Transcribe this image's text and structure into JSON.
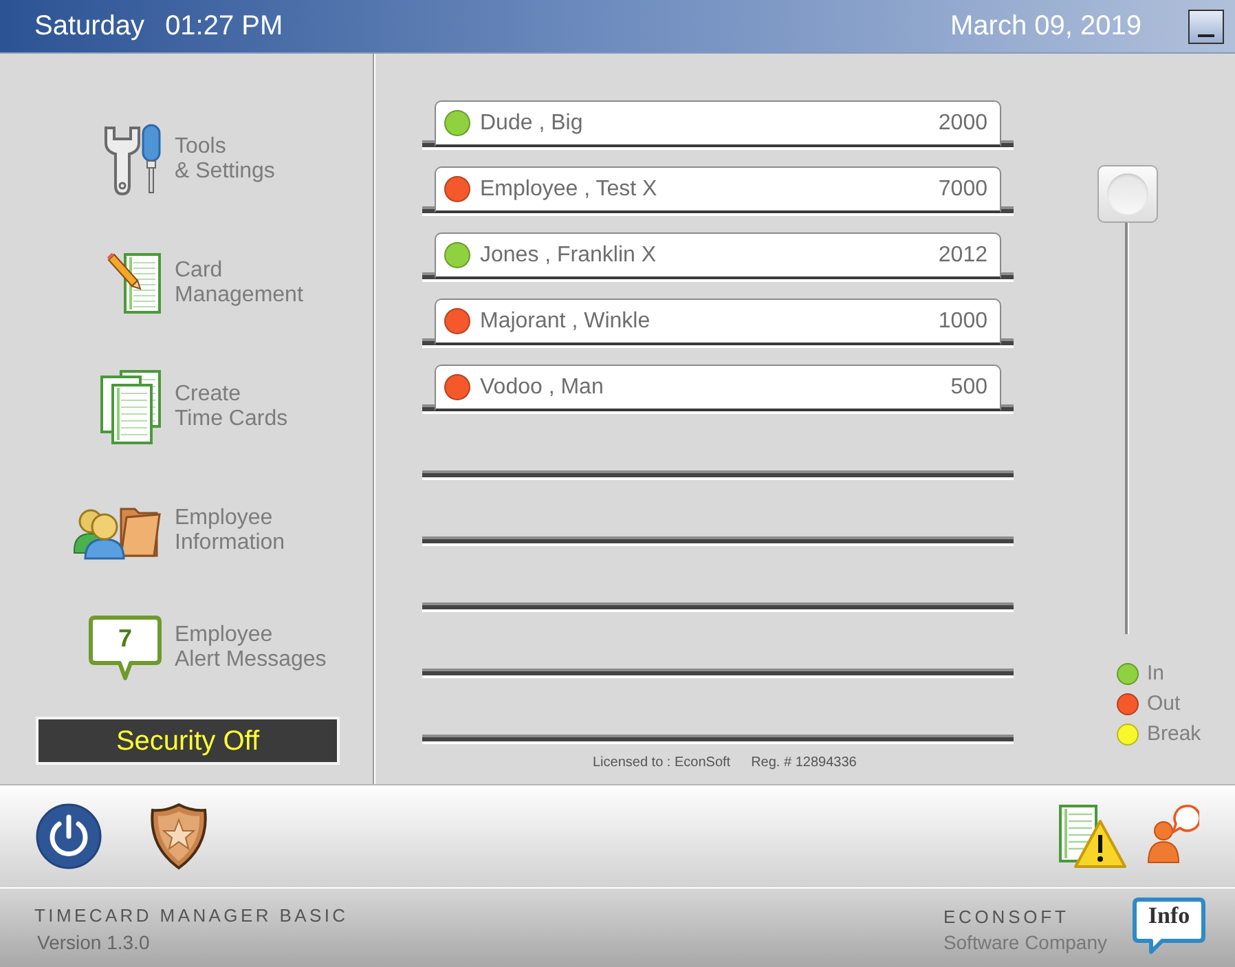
{
  "header": {
    "day": "Saturday",
    "time": "01:27 PM",
    "date": "March 09, 2019"
  },
  "sidebar": {
    "items": [
      {
        "kind": "tools",
        "label_lines": [
          "Tools",
          "& Settings"
        ]
      },
      {
        "kind": "card",
        "label_lines": [
          "Card",
          "Management"
        ]
      },
      {
        "kind": "timecards",
        "label_lines": [
          "Create",
          "Time Cards"
        ]
      },
      {
        "kind": "employee",
        "label_lines": [
          "Employee",
          "Information"
        ]
      },
      {
        "kind": "alerts",
        "label_lines": [
          "Employee",
          "Alert Messages"
        ],
        "badge": "7"
      }
    ],
    "security": {
      "label": "Security Off"
    }
  },
  "employees": [
    {
      "name": "Dude , Big",
      "number": "2000",
      "color": "#8fd13f"
    },
    {
      "name": "Employee , Test X",
      "number": "7000",
      "color": "#f5582b"
    },
    {
      "name": "Jones , Franklin X",
      "number": "2012",
      "color": "#8fd13f"
    },
    {
      "name": "Majorant , Winkle",
      "number": "1000",
      "color": "#f5582b"
    },
    {
      "name": "Vodoo , Man",
      "number": "500",
      "color": "#f5582b"
    }
  ],
  "legend": [
    {
      "label": "In",
      "color": "#8fd13f"
    },
    {
      "label": "Out",
      "color": "#f5582b"
    },
    {
      "label": "Break",
      "color": "#f7f72b"
    }
  ],
  "license": {
    "licensed_to": "Licensed to : EconSoft",
    "registration": "Reg. # 12894336"
  },
  "footer": {
    "product": "TIMECARD MANAGER BASIC",
    "version": "Version 1.3.0",
    "company": "ECONSOFT",
    "company_tagline": "Software Company",
    "info_button": "Info"
  }
}
